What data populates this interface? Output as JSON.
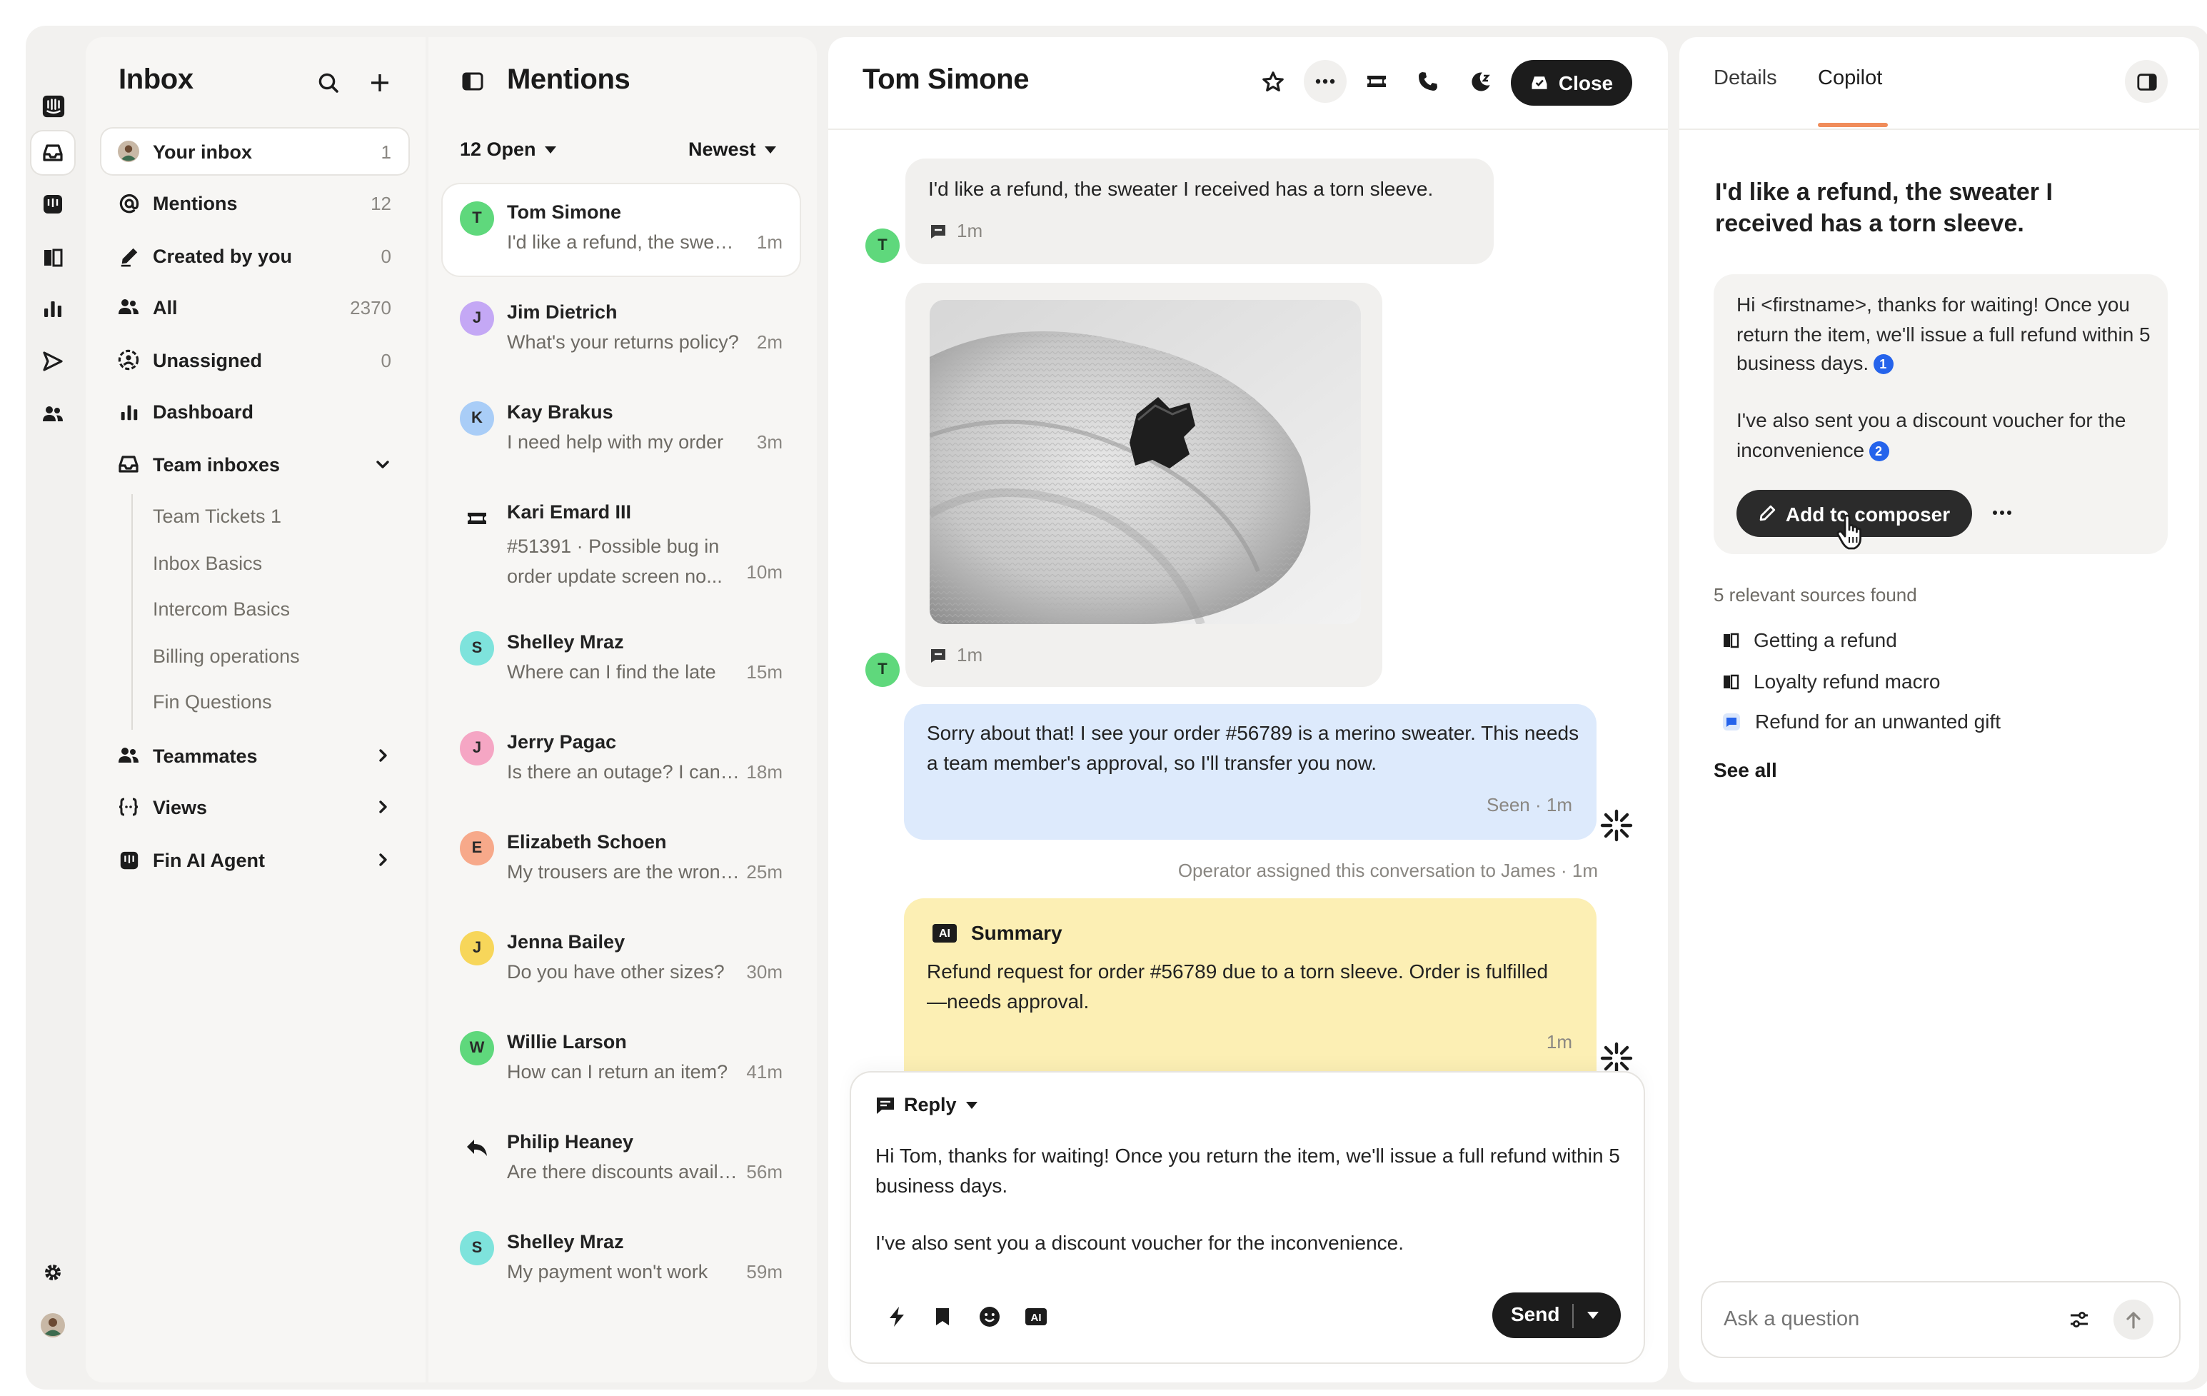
{
  "nav": {
    "title": "Inbox",
    "items": [
      {
        "label": "Your inbox",
        "count": "1"
      },
      {
        "label": "Mentions",
        "count": "12"
      },
      {
        "label": "Created by you",
        "count": "0"
      },
      {
        "label": "All",
        "count": "2370"
      },
      {
        "label": "Unassigned",
        "count": "0"
      },
      {
        "label": "Dashboard",
        "count": ""
      },
      {
        "label": "Team inboxes",
        "count": ""
      }
    ],
    "team_inboxes": [
      "Team Tickets 1",
      "Inbox Basics",
      "Intercom Basics",
      "Billing operations",
      "Fin Questions"
    ],
    "groups": [
      {
        "label": "Teammates"
      },
      {
        "label": "Views"
      },
      {
        "label": "Fin AI Agent"
      }
    ]
  },
  "list": {
    "title": "Mentions",
    "filter": "12 Open",
    "sort": "Newest",
    "conversations": [
      {
        "initial": "T",
        "name": "Tom Simone",
        "preview": "I'd like a refund, the sweater I received",
        "time": "1m",
        "color": "#5fd87c"
      },
      {
        "initial": "J",
        "name": "Jim Dietrich",
        "preview": "What's your returns policy?",
        "time": "2m",
        "color": "#c4a8f5"
      },
      {
        "initial": "K",
        "name": "Kay Brakus",
        "preview": "I need help with my order",
        "time": "3m",
        "color": "#a9cdf7"
      },
      {
        "initial": "",
        "name": "Kari Emard III",
        "preview": "#51391 · Possible bug in order update screen no...",
        "time": "10m",
        "color": ""
      },
      {
        "initial": "S",
        "name": "Shelley Mraz",
        "preview": "Where can I find the late",
        "time": "15m",
        "color": "#7ee3dc"
      },
      {
        "initial": "J",
        "name": "Jerry Pagac",
        "preview": "Is there an outage? I can't log in",
        "time": "18m",
        "color": "#f5a6c4"
      },
      {
        "initial": "E",
        "name": "Elizabeth Schoen",
        "preview": "My trousers are the wrong size",
        "time": "25m",
        "color": "#f7a98a"
      },
      {
        "initial": "J",
        "name": "Jenna Bailey",
        "preview": "Do you have other sizes?",
        "time": "30m",
        "color": "#f7d65a"
      },
      {
        "initial": "W",
        "name": "Willie Larson",
        "preview": "How can I return an item?",
        "time": "41m",
        "color": "#5fd87c"
      },
      {
        "initial": "",
        "name": "Philip Heaney",
        "preview": "Are there discounts available?",
        "time": "56m",
        "color": ""
      },
      {
        "initial": "S",
        "name": "Shelley Mraz",
        "preview": "My payment won't work",
        "time": "59m",
        "color": "#7ee3dc"
      }
    ]
  },
  "conversation": {
    "title": "Tom Simone",
    "close_label": "Close",
    "avatar_initial": "T",
    "msg1": {
      "text": "I'd like a refund, the sweater I received has a torn sleeve.",
      "time": "1m"
    },
    "msg2": {
      "time": "1m"
    },
    "msg3": {
      "text": "Sorry about that! I see your order #56789 is a merino sweater. This needs a team member's approval, so I'll transfer you now.",
      "status": "Seen · 1m"
    },
    "event": "Operator assigned this conversation to James · 1m",
    "summary": {
      "badge": "AI",
      "title": "Summary",
      "text": "Refund request for order #56789 due to a torn sleeve. Order is fulfilled—needs approval.",
      "time": "1m"
    },
    "composer": {
      "mode": "Reply",
      "line1": "Hi Tom, thanks for waiting! Once you return the item, we'll issue a full refund within 5 business days.",
      "line2": "I've also sent you a discount voucher for the inconvenience.",
      "send_label": "Send",
      "ai_badge": "AI"
    }
  },
  "copilot": {
    "tabs": [
      "Details",
      "Copilot"
    ],
    "active_tab": "Copilot",
    "question": "I'd like a refund, the sweater I received has a torn sleeve.",
    "answer_p1": "Hi <firstname>, thanks for waiting! Once you return the item, we'll issue a full refund within 5 business days.",
    "answer_p2": "I've also sent you a discount voucher for the inconvenience",
    "ref1": "1",
    "ref2": "2",
    "add_label": "Add to composer",
    "sources_heading": "5 relevant sources found",
    "sources": [
      "Getting a refund",
      "Loyalty refund macro",
      "Refund for an unwanted gift"
    ],
    "see_all": "See all",
    "ask_placeholder": "Ask a question"
  },
  "colors": {
    "accent": "#f08c5a",
    "ai_blue": "#2563eb",
    "summary_bg": "#fcefb4",
    "bot_bubble": "#ddeafc"
  }
}
